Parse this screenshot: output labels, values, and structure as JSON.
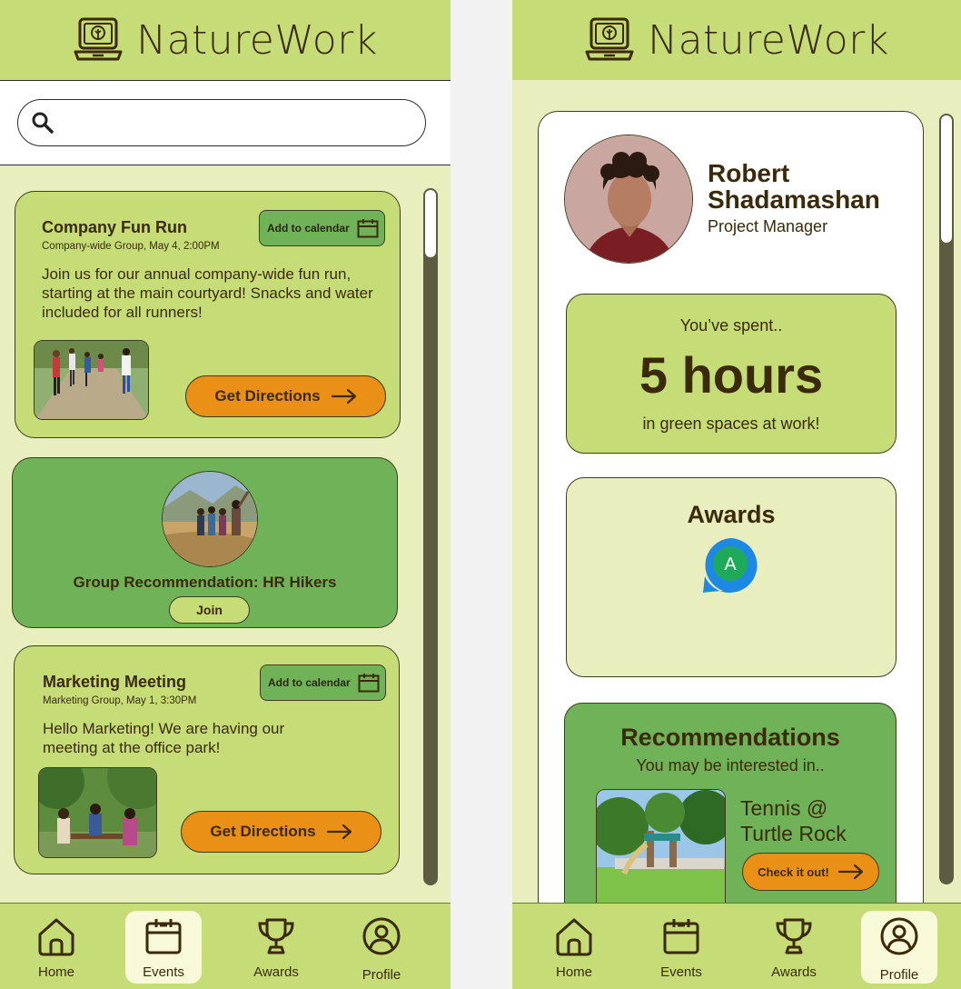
{
  "app": {
    "title": "NatureWork"
  },
  "events_screen": {
    "search": {
      "placeholder": ""
    },
    "events": [
      {
        "title": "Company Fun Run",
        "meta": "Company-wide Group, May 4, 2:00PM",
        "description": "Join us for our annual company-wide fun run, starting at the main courtyard! Snacks and water included for all runners!",
        "calendar_label": "Add to calendar",
        "directions_label": "Get Directions"
      },
      {
        "title": "Marketing Meeting",
        "meta": "Marketing Group, May 1, 3:30PM",
        "description": "Hello Marketing! We are having our meeting at the office park!",
        "calendar_label": "Add to calendar",
        "directions_label": "Get Directions"
      }
    ],
    "group_recommendation": {
      "title": "Group Recommendation: HR Hikers",
      "join_label": "Join"
    }
  },
  "profile_screen": {
    "name": "Robert Shadamashan",
    "role": "Project Manager",
    "stat": {
      "pre": "You’ve spent..",
      "value": "5 hours",
      "post": "in green spaces at work!"
    },
    "awards": {
      "title": "Awards",
      "badge_letter": "A"
    },
    "recommendations": {
      "title": "Recommendations",
      "subtitle": "You may be interested in..",
      "place": "Tennis @ Turtle Rock",
      "cta": "Check it out!"
    }
  },
  "tabs": [
    {
      "label": "Home",
      "icon": "home-icon"
    },
    {
      "label": "Events",
      "icon": "calendar-icon"
    },
    {
      "label": "Awards",
      "icon": "trophy-icon"
    },
    {
      "label": "Profile",
      "icon": "person-icon"
    }
  ],
  "active_tab": {
    "events_screen": "Events",
    "profile_screen": "Profile"
  },
  "colors": {
    "header": "#c5dc77",
    "background": "#e8eebd",
    "green_dark": "#6fb257",
    "orange": "#ea9017",
    "text": "#3b2a0a",
    "scrollbar": "#5c5c40"
  }
}
